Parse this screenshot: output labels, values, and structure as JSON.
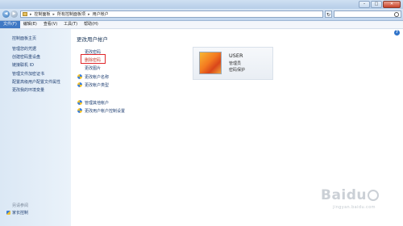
{
  "window": {
    "controls": {
      "minimize": "–",
      "maximize": "□",
      "close": "✕"
    }
  },
  "address": {
    "crumbs": [
      "控制面板",
      "所有控制面板项",
      "用户帐户"
    ],
    "separator": "▸",
    "refresh_icon": "↻"
  },
  "menu": [
    "文件(F)",
    "编辑(E)",
    "查看(V)",
    "工具(T)",
    "帮助(H)"
  ],
  "sidebar": {
    "links": [
      "控制面板主页",
      "管理您的凭据",
      "创建密码重设盘",
      "链接联机 ID",
      "管理文件加密证书",
      "配置高级用户配置文件属性",
      "更改我的环境变量"
    ],
    "see_also": "另请参阅",
    "bottom_link": "家长控制"
  },
  "content": {
    "heading": "更改用户帐户",
    "tasks": [
      "更改密码",
      "删除密码",
      "更改图片",
      "更改帐户名称",
      "更改帐户类型"
    ],
    "tasks2": [
      "管理其他帐户",
      "更改用户帐户控制设置"
    ]
  },
  "user": {
    "name": "USER",
    "role": "管理员",
    "status": "密码保护"
  },
  "watermark": {
    "logo": "Baidu",
    "site": "jingyan.baidu.com"
  },
  "colors": {
    "accent": "#3f78c4",
    "highlight_border": "#e0262a",
    "link": "#1f3f72"
  }
}
